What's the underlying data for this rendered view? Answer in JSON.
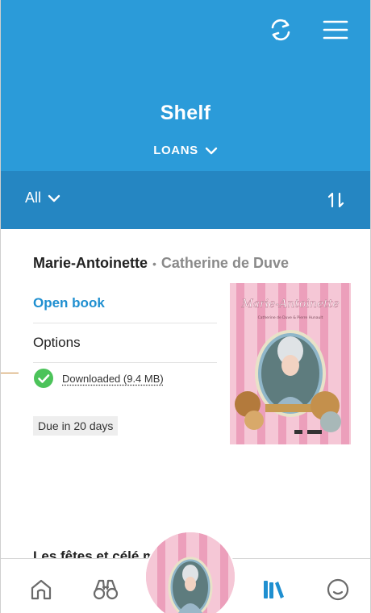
{
  "header": {
    "title": "Shelf",
    "loans_label": "LOANS",
    "icons": [
      "sync-icon",
      "menu-icon"
    ]
  },
  "filter": {
    "label": "All",
    "sort_icon": "sort-icon"
  },
  "book": {
    "title": "Marie-Antoinette",
    "separator": "•",
    "author": "Catherine de Duve",
    "open_label": "Open book",
    "options_label": "Options",
    "download_status": "Downloaded (9.4 MB)",
    "due": "Due in 20 days",
    "cover_title": "Marie-Antoinette",
    "cover_subtitle": "Catherine de Duve & Pierre Hunault"
  },
  "next_book": {
    "title_partial": "Les fêtes et célé      monde: Les"
  },
  "nav": {
    "items": [
      "home-icon",
      "explore-icon",
      "current-book",
      "shelf-icon",
      "profile-icon"
    ]
  },
  "colors": {
    "header_blue": "#2b9bd9",
    "filter_blue": "#2586c2",
    "link_blue": "#1f8fd0",
    "success_green": "#4cc35a",
    "shelf_active": "#1f8fd0",
    "nav_icon": "#6a6a6a"
  }
}
